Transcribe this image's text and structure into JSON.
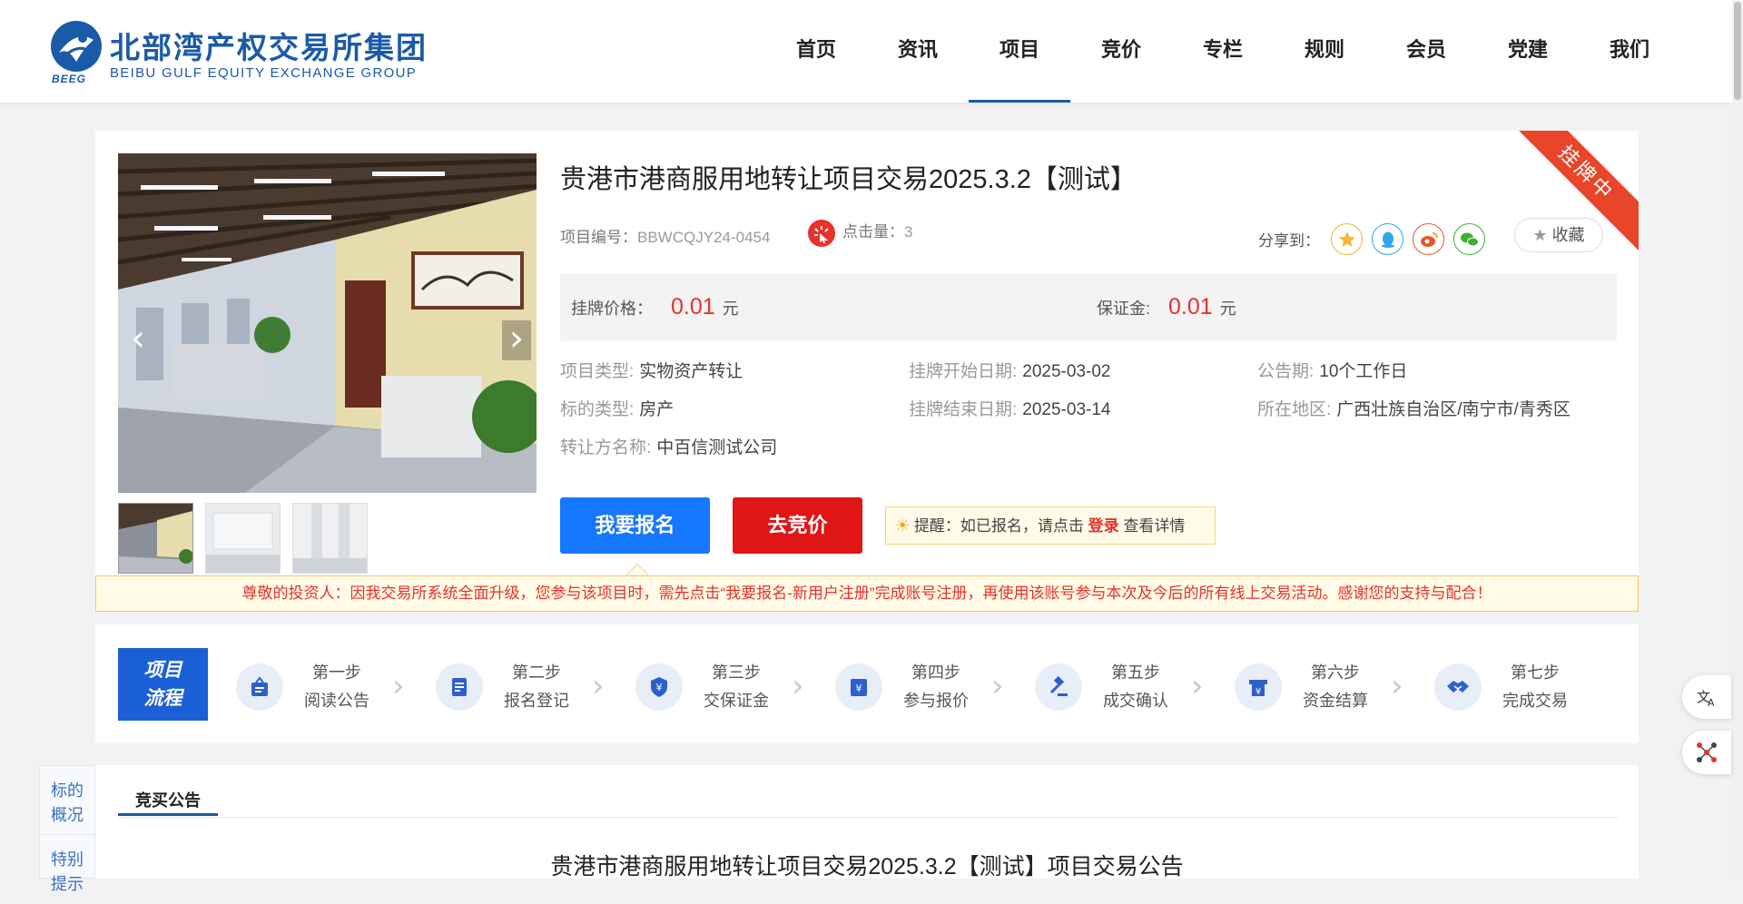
{
  "header": {
    "logo_cn": "北部湾产权交易所集团",
    "logo_en": "BEIBU GULF EQUITY EXCHANGE GROUP",
    "logo_abbr": "BEEG",
    "brand_color": "#1b5aa8",
    "nav": [
      {
        "label": "首页",
        "active": false
      },
      {
        "label": "资讯",
        "active": false
      },
      {
        "label": "项目",
        "active": true
      },
      {
        "label": "竞价",
        "active": false
      },
      {
        "label": "专栏",
        "active": false
      },
      {
        "label": "规则",
        "active": false
      },
      {
        "label": "会员",
        "active": false
      },
      {
        "label": "党建",
        "active": false
      },
      {
        "label": "我们",
        "active": false
      }
    ]
  },
  "project": {
    "title": "贵港市港商服用地转让项目交易2025.3.2【测试】",
    "status_ribbon": "挂牌中",
    "code_label": "项目编号：",
    "code_value": "BBWCQJY24-0454",
    "clicks_label": "点击量：",
    "clicks_value": "3",
    "share_label": "分享到：",
    "share_icons": [
      "qzone-icon",
      "qq-icon",
      "weibo-icon",
      "wechat-icon"
    ],
    "favorite_label": "收藏",
    "price_label": "挂牌价格：",
    "price_value": "0.01",
    "price_unit": "元",
    "deposit_label": "保证金:",
    "deposit_value": "0.01",
    "deposit_unit": "元",
    "info": {
      "type_key": "项目类型:",
      "type_val": "实物资产转让",
      "start_key": "挂牌开始日期:",
      "start_val": "2025-03-02",
      "period_key": "公告期:",
      "period_val": "10个工作日",
      "subject_key": "标的类型:",
      "subject_val": "房产",
      "end_key": "挂牌结束日期:",
      "end_val": "2025-03-14",
      "region_key": "所在地区:",
      "region_val": "广西壮族自治区/南宁市/青秀区",
      "transferor_key": "转让方名称:",
      "transferor_val": "中百信测试公司"
    },
    "register_button": "我要报名",
    "bid_button": "去竞价",
    "tip_prefix": "提醒：如已报名，请点击",
    "tip_login": "登录",
    "tip_suffix": "查看详情",
    "accent_red": "#e8312b",
    "accent_blue": "#1677ff"
  },
  "notice": "尊敬的投资人：因我交易所系统全面升级，您参与该项目时，需先点击“我要报名-新用户注册”完成账号注册，再使用该账号参与本次及今后的所有线上交易活动。感谢您的支持与配合！",
  "process": {
    "badge_line1": "项目",
    "badge_line2": "流程",
    "steps": [
      {
        "step": "第一步",
        "label": "阅读公告",
        "icon": "announcement-icon"
      },
      {
        "step": "第二步",
        "label": "报名登记",
        "icon": "register-icon"
      },
      {
        "step": "第三步",
        "label": "交保证金",
        "icon": "deposit-shield-icon"
      },
      {
        "step": "第四步",
        "label": "参与报价",
        "icon": "quote-icon"
      },
      {
        "step": "第五步",
        "label": "成交确认",
        "icon": "gavel-icon"
      },
      {
        "step": "第六步",
        "label": "资金结算",
        "icon": "settlement-icon"
      },
      {
        "step": "第七步",
        "label": "完成交易",
        "icon": "handshake-icon"
      }
    ]
  },
  "bottom": {
    "side_tabs": [
      "标的\n概况",
      "特别\n提示"
    ],
    "content_tab": "竞买公告",
    "content_title": "贵港市港商服用地转让项目交易2025.3.2【测试】项目交易公告"
  }
}
